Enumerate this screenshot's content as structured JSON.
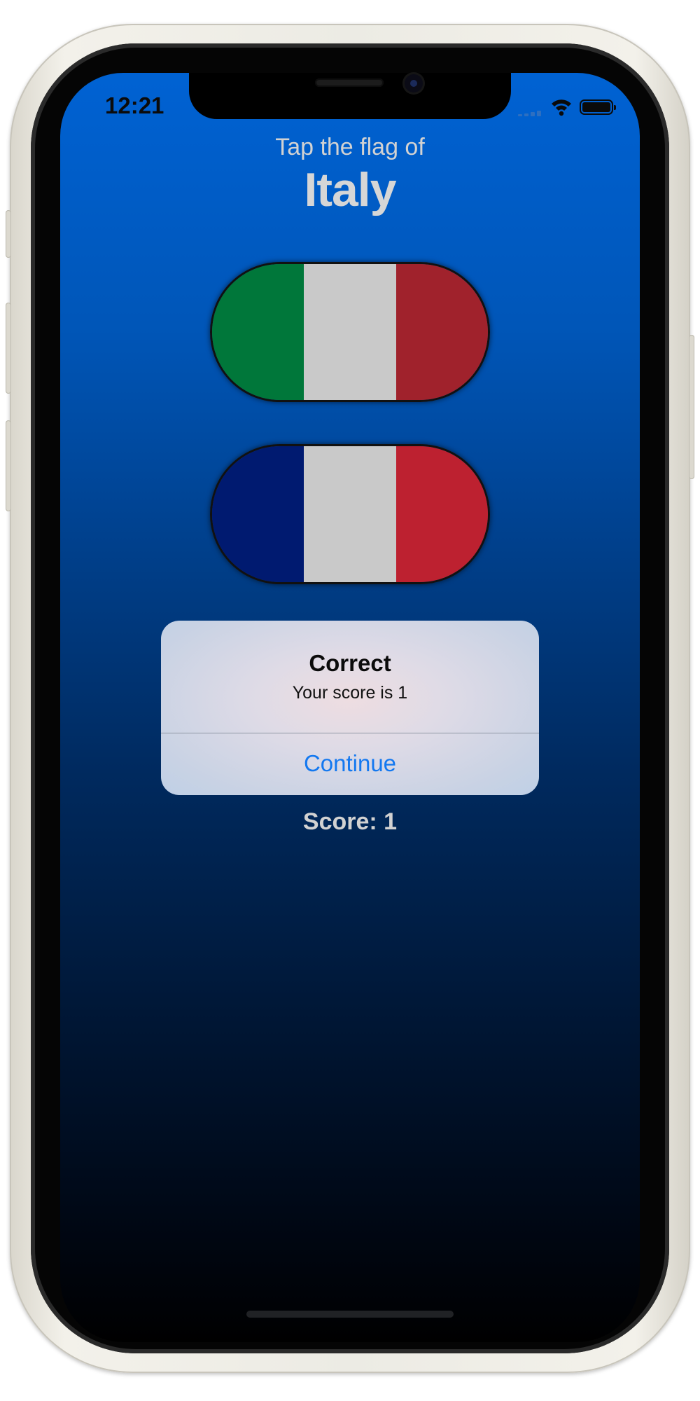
{
  "status_bar": {
    "time": "12:21",
    "signal_icon": "cellular-signal-icon",
    "wifi_icon": "wifi-icon",
    "battery_icon": "battery-icon"
  },
  "game": {
    "prompt": "Tap the flag of",
    "country": "Italy",
    "score_label": "Score: 1"
  },
  "flags": [
    {
      "country": "Italy",
      "stripes": [
        "#00773a",
        "#c9c9c9",
        "#a0222c"
      ]
    },
    {
      "country": "France",
      "stripes": [
        "#001a70",
        "#c9c9c9",
        "#bd2130"
      ]
    }
  ],
  "alert": {
    "title": "Correct",
    "message": "Your score is 1",
    "button_label": "Continue"
  },
  "colors": {
    "background_top": "#0062d3",
    "background_bottom": "#000000",
    "alert_button": "#1378f0"
  }
}
